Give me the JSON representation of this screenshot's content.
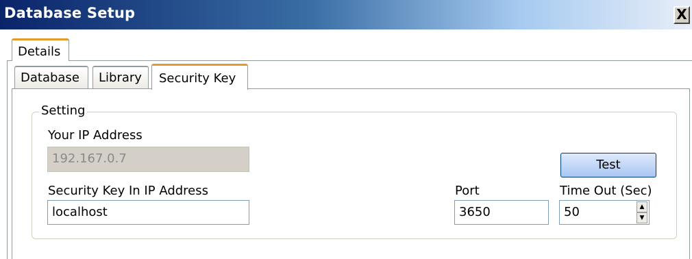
{
  "window": {
    "title": "Database Setup",
    "close_glyph": "X"
  },
  "tabs": {
    "outer": {
      "label": "Details"
    },
    "inner": [
      {
        "label": "Database",
        "active": false
      },
      {
        "label": "Library",
        "active": false
      },
      {
        "label": "Security Key",
        "active": true
      }
    ]
  },
  "group": {
    "legend": "Setting",
    "your_ip_label": "Your IP Address",
    "your_ip_value": "192.167.0.7",
    "security_ip_label": "Security Key In IP Address",
    "security_ip_value": "localhost",
    "port_label": "Port",
    "port_value": "3650",
    "timeout_label": "Time Out (Sec)",
    "timeout_value": "50",
    "test_button_label": "Test"
  },
  "icons": {
    "spin_up": "▲",
    "spin_down": "▼"
  }
}
